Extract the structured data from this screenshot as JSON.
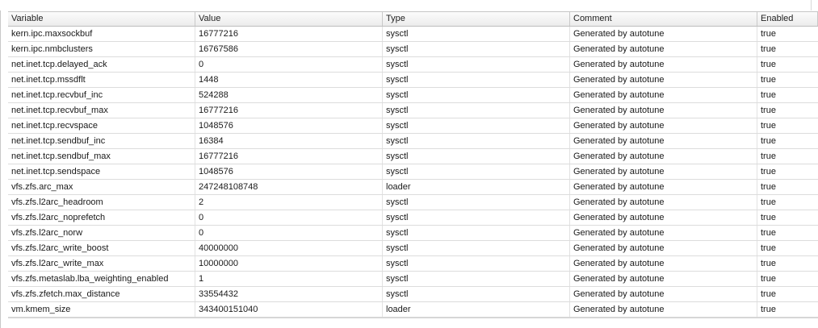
{
  "table": {
    "columns": [
      "Variable",
      "Value",
      "Type",
      "Comment",
      "Enabled"
    ],
    "rows": [
      [
        "kern.ipc.maxsockbuf",
        "16777216",
        "sysctl",
        "Generated by autotune",
        "true"
      ],
      [
        "kern.ipc.nmbclusters",
        "16767586",
        "sysctl",
        "Generated by autotune",
        "true"
      ],
      [
        "net.inet.tcp.delayed_ack",
        "0",
        "sysctl",
        "Generated by autotune",
        "true"
      ],
      [
        "net.inet.tcp.mssdflt",
        "1448",
        "sysctl",
        "Generated by autotune",
        "true"
      ],
      [
        "net.inet.tcp.recvbuf_inc",
        "524288",
        "sysctl",
        "Generated by autotune",
        "true"
      ],
      [
        "net.inet.tcp.recvbuf_max",
        "16777216",
        "sysctl",
        "Generated by autotune",
        "true"
      ],
      [
        "net.inet.tcp.recvspace",
        "1048576",
        "sysctl",
        "Generated by autotune",
        "true"
      ],
      [
        "net.inet.tcp.sendbuf_inc",
        "16384",
        "sysctl",
        "Generated by autotune",
        "true"
      ],
      [
        "net.inet.tcp.sendbuf_max",
        "16777216",
        "sysctl",
        "Generated by autotune",
        "true"
      ],
      [
        "net.inet.tcp.sendspace",
        "1048576",
        "sysctl",
        "Generated by autotune",
        "true"
      ],
      [
        "vfs.zfs.arc_max",
        "247248108748",
        "loader",
        "Generated by autotune",
        "true"
      ],
      [
        "vfs.zfs.l2arc_headroom",
        "2",
        "sysctl",
        "Generated by autotune",
        "true"
      ],
      [
        "vfs.zfs.l2arc_noprefetch",
        "0",
        "sysctl",
        "Generated by autotune",
        "true"
      ],
      [
        "vfs.zfs.l2arc_norw",
        "0",
        "sysctl",
        "Generated by autotune",
        "true"
      ],
      [
        "vfs.zfs.l2arc_write_boost",
        "40000000",
        "sysctl",
        "Generated by autotune",
        "true"
      ],
      [
        "vfs.zfs.l2arc_write_max",
        "10000000",
        "sysctl",
        "Generated by autotune",
        "true"
      ],
      [
        "vfs.zfs.metaslab.lba_weighting_enabled",
        "1",
        "sysctl",
        "Generated by autotune",
        "true"
      ],
      [
        "vfs.zfs.zfetch.max_distance",
        "33554432",
        "sysctl",
        "Generated by autotune",
        "true"
      ],
      [
        "vm.kmem_size",
        "343400151040",
        "loader",
        "Generated by autotune",
        "true"
      ]
    ]
  }
}
